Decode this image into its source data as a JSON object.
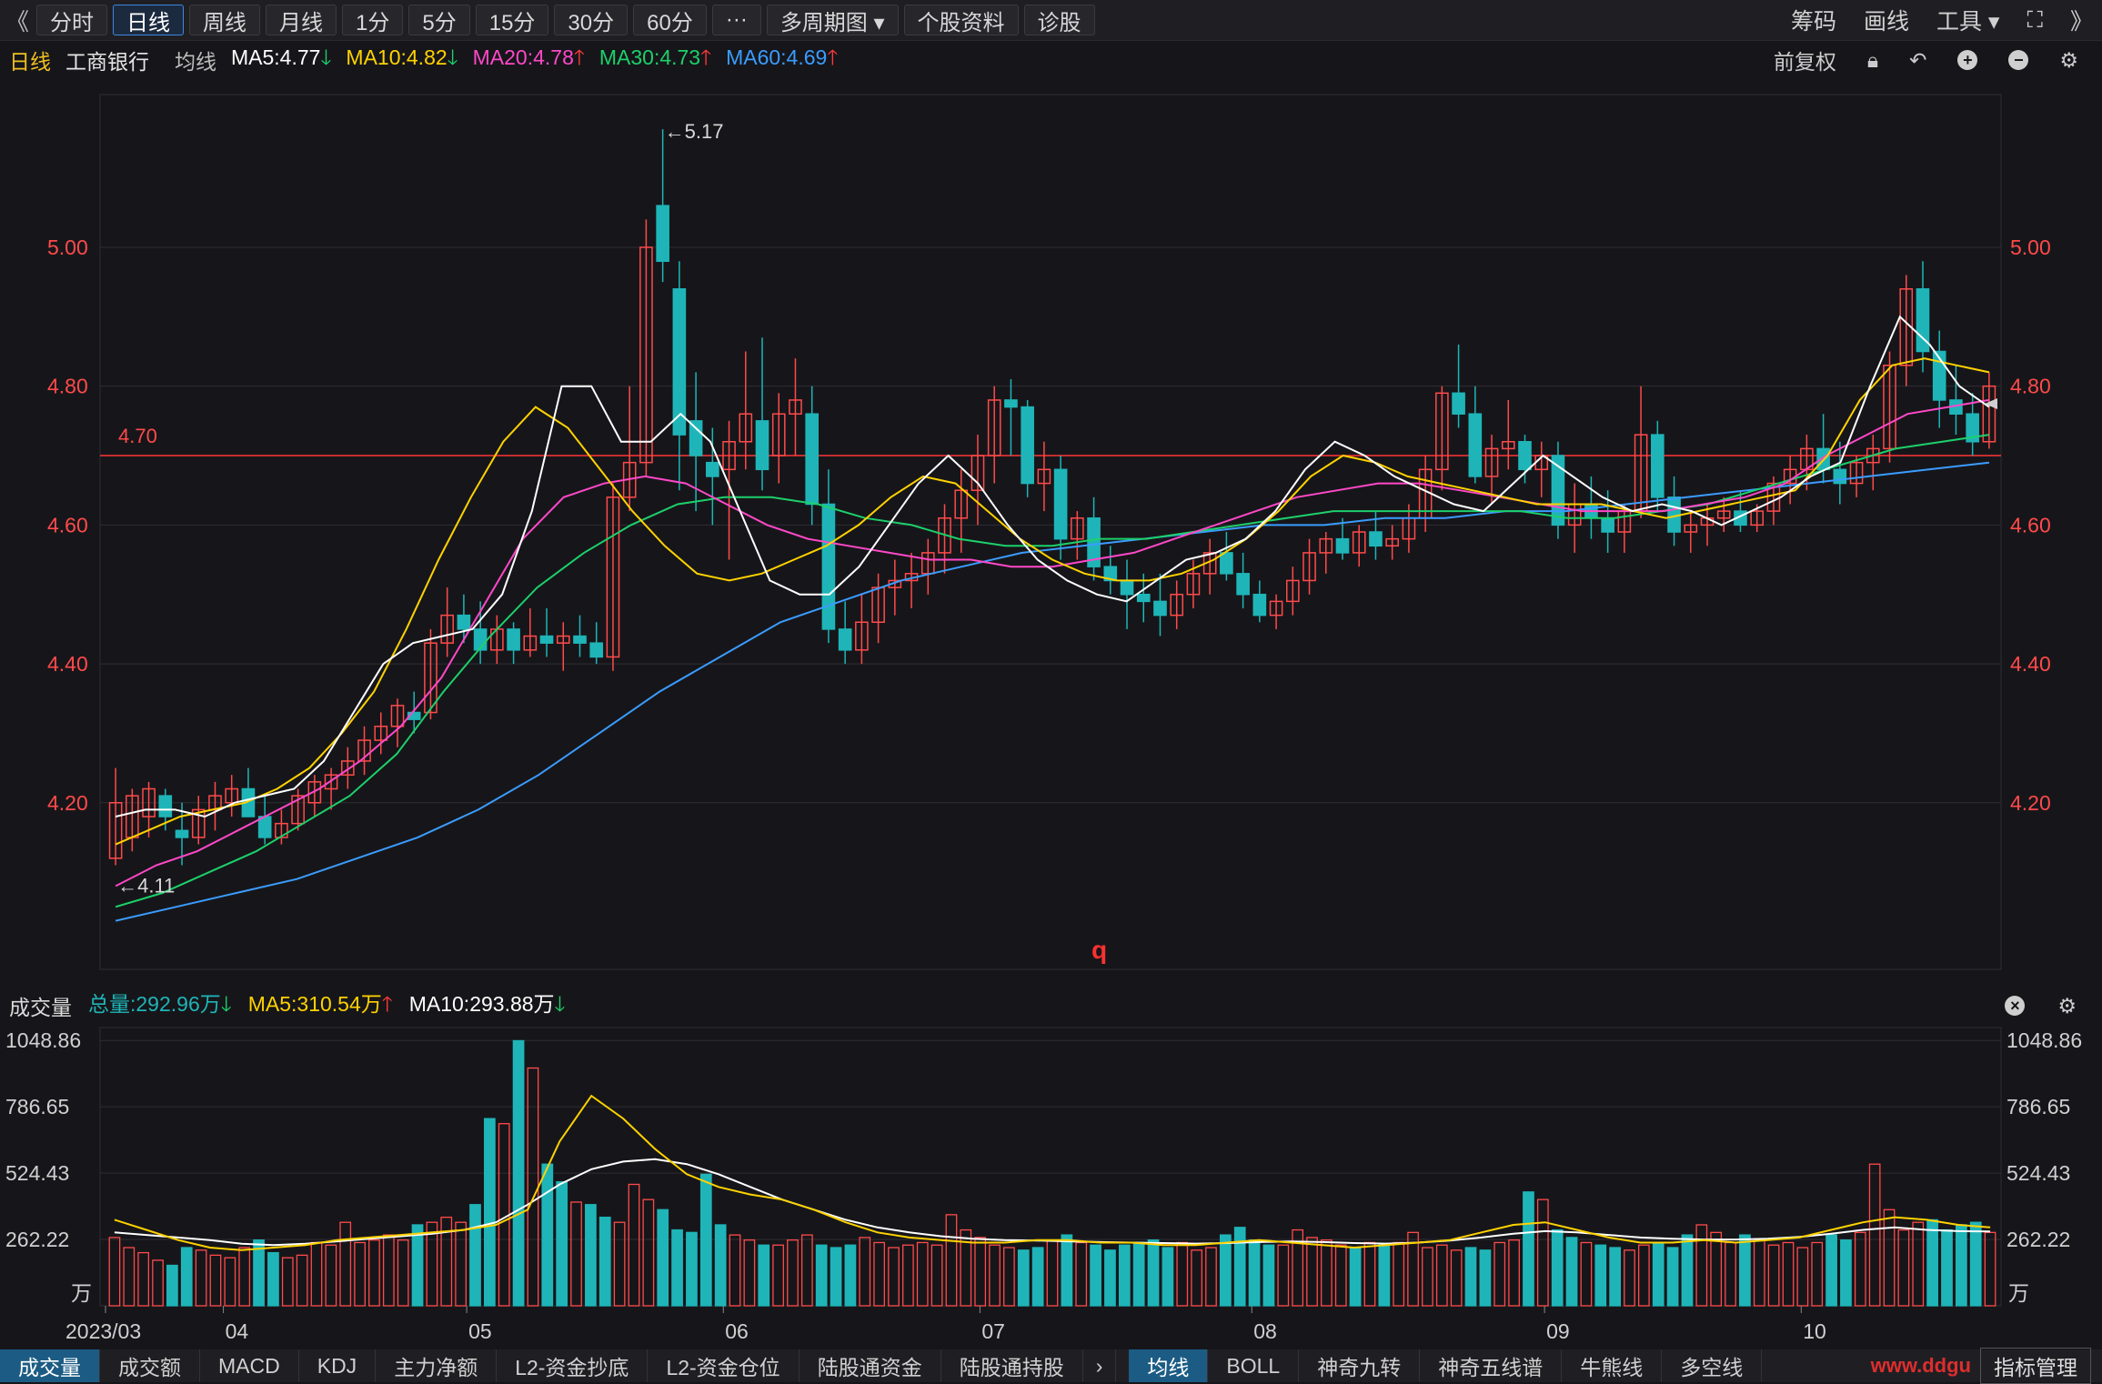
{
  "toolbar": {
    "back": "《",
    "periods": [
      "分时",
      "日线",
      "周线",
      "月线",
      "1分",
      "5分",
      "15分",
      "30分",
      "60分",
      "···",
      "多周期图 ▾",
      "个股资料",
      "诊股"
    ],
    "active_index": 1,
    "right": [
      "筹码",
      "画线",
      "工具 ▾"
    ],
    "expand": "⛶",
    "forward": "》"
  },
  "legend": {
    "period": "日线",
    "stock": "工商银行",
    "ma_label": "均线",
    "ma5": "MA5:4.77",
    "ma10": "MA10:4.82",
    "ma20": "MA20:4.78",
    "ma30": "MA30:4.73",
    "ma60": "MA60:4.69",
    "adjust": "前复权"
  },
  "colors": {
    "up": "#ff4a4a",
    "down": "#1fb5b8",
    "ma5": "#ffffff",
    "ma10": "#ffd200",
    "ma20": "#ff48c8",
    "ma30": "#1dd06a",
    "ma60": "#3b9cff"
  },
  "volume_legend": {
    "title": "成交量",
    "total": "总量:292.96万",
    "ma5": "MA5:310.54万",
    "ma10": "MA10:293.88万"
  },
  "chart_data": {
    "type": "candlestick",
    "price_axis": {
      "ticks": [
        "5.00",
        "4.80",
        "4.60",
        "4.40",
        "4.20"
      ]
    },
    "reference_line": {
      "value": 4.7,
      "label": "4.70"
    },
    "annotations": {
      "high": "←5.17",
      "low": "←4.11",
      "cursor_label": "q"
    },
    "x_labels": [
      "2023/03",
      "04",
      "05",
      "06",
      "07",
      "08",
      "09",
      "10"
    ],
    "candles_ohlc": [
      [
        4.12,
        4.25,
        4.11,
        4.2
      ],
      [
        4.15,
        4.22,
        4.13,
        4.21
      ],
      [
        4.18,
        4.23,
        4.15,
        4.22
      ],
      [
        4.21,
        4.22,
        4.16,
        4.18
      ],
      [
        4.16,
        4.2,
        4.11,
        4.15
      ],
      [
        4.15,
        4.21,
        4.14,
        4.19
      ],
      [
        4.19,
        4.23,
        4.16,
        4.21
      ],
      [
        4.2,
        4.24,
        4.18,
        4.22
      ],
      [
        4.22,
        4.25,
        4.18,
        4.18
      ],
      [
        4.18,
        4.21,
        4.14,
        4.15
      ],
      [
        4.15,
        4.19,
        4.14,
        4.17
      ],
      [
        4.17,
        4.22,
        4.16,
        4.21
      ],
      [
        4.2,
        4.24,
        4.18,
        4.23
      ],
      [
        4.22,
        4.25,
        4.19,
        4.24
      ],
      [
        4.24,
        4.28,
        4.22,
        4.26
      ],
      [
        4.26,
        4.31,
        4.24,
        4.29
      ],
      [
        4.29,
        4.33,
        4.27,
        4.31
      ],
      [
        4.31,
        4.35,
        4.28,
        4.34
      ],
      [
        4.33,
        4.36,
        4.3,
        4.32
      ],
      [
        4.33,
        4.45,
        4.32,
        4.43
      ],
      [
        4.43,
        4.51,
        4.41,
        4.47
      ],
      [
        4.47,
        4.5,
        4.43,
        4.45
      ],
      [
        4.45,
        4.49,
        4.4,
        4.42
      ],
      [
        4.42,
        4.47,
        4.4,
        4.45
      ],
      [
        4.45,
        4.46,
        4.4,
        4.42
      ],
      [
        4.42,
        4.48,
        4.41,
        4.44
      ],
      [
        4.44,
        4.48,
        4.41,
        4.43
      ],
      [
        4.43,
        4.46,
        4.39,
        4.44
      ],
      [
        4.44,
        4.47,
        4.41,
        4.43
      ],
      [
        4.43,
        4.46,
        4.4,
        4.41
      ],
      [
        4.41,
        4.66,
        4.39,
        4.64
      ],
      [
        4.64,
        4.8,
        4.62,
        4.69
      ],
      [
        4.69,
        5.04,
        4.67,
        5.0
      ],
      [
        5.06,
        5.17,
        4.95,
        4.98
      ],
      [
        4.94,
        4.98,
        4.65,
        4.73
      ],
      [
        4.75,
        4.82,
        4.62,
        4.7
      ],
      [
        4.69,
        4.74,
        4.6,
        4.67
      ],
      [
        4.68,
        4.75,
        4.55,
        4.72
      ],
      [
        4.72,
        4.85,
        4.68,
        4.76
      ],
      [
        4.75,
        4.87,
        4.65,
        4.68
      ],
      [
        4.7,
        4.79,
        4.66,
        4.76
      ],
      [
        4.76,
        4.84,
        4.7,
        4.78
      ],
      [
        4.76,
        4.8,
        4.6,
        4.63
      ],
      [
        4.63,
        4.68,
        4.43,
        4.45
      ],
      [
        4.45,
        4.49,
        4.4,
        4.42
      ],
      [
        4.42,
        4.5,
        4.4,
        4.46
      ],
      [
        4.46,
        4.53,
        4.43,
        4.51
      ],
      [
        4.51,
        4.55,
        4.47,
        4.52
      ],
      [
        4.52,
        4.56,
        4.48,
        4.53
      ],
      [
        4.53,
        4.58,
        4.5,
        4.56
      ],
      [
        4.56,
        4.63,
        4.53,
        4.61
      ],
      [
        4.61,
        4.68,
        4.56,
        4.65
      ],
      [
        4.65,
        4.73,
        4.6,
        4.7
      ],
      [
        4.7,
        4.8,
        4.66,
        4.78
      ],
      [
        4.78,
        4.81,
        4.7,
        4.77
      ],
      [
        4.77,
        4.78,
        4.64,
        4.66
      ],
      [
        4.66,
        4.72,
        4.62,
        4.68
      ],
      [
        4.68,
        4.7,
        4.55,
        4.58
      ],
      [
        4.58,
        4.62,
        4.55,
        4.61
      ],
      [
        4.61,
        4.64,
        4.52,
        4.54
      ],
      [
        4.54,
        4.57,
        4.5,
        4.52
      ],
      [
        4.52,
        4.55,
        4.45,
        4.5
      ],
      [
        4.5,
        4.53,
        4.46,
        4.49
      ],
      [
        4.49,
        4.53,
        4.44,
        4.47
      ],
      [
        4.47,
        4.52,
        4.45,
        4.5
      ],
      [
        4.5,
        4.55,
        4.48,
        4.53
      ],
      [
        4.53,
        4.58,
        4.5,
        4.56
      ],
      [
        4.56,
        4.59,
        4.52,
        4.53
      ],
      [
        4.53,
        4.56,
        4.48,
        4.5
      ],
      [
        4.5,
        4.52,
        4.46,
        4.47
      ],
      [
        4.47,
        4.5,
        4.45,
        4.49
      ],
      [
        4.49,
        4.54,
        4.47,
        4.52
      ],
      [
        4.52,
        4.58,
        4.5,
        4.56
      ],
      [
        4.56,
        4.59,
        4.53,
        4.58
      ],
      [
        4.58,
        4.61,
        4.55,
        4.56
      ],
      [
        4.56,
        4.6,
        4.54,
        4.59
      ],
      [
        4.59,
        4.62,
        4.55,
        4.57
      ],
      [
        4.57,
        4.6,
        4.55,
        4.58
      ],
      [
        4.58,
        4.63,
        4.56,
        4.61
      ],
      [
        4.61,
        4.7,
        4.59,
        4.68
      ],
      [
        4.68,
        4.8,
        4.65,
        4.79
      ],
      [
        4.79,
        4.86,
        4.74,
        4.76
      ],
      [
        4.76,
        4.8,
        4.66,
        4.67
      ],
      [
        4.67,
        4.73,
        4.63,
        4.71
      ],
      [
        4.71,
        4.78,
        4.68,
        4.72
      ],
      [
        4.72,
        4.73,
        4.66,
        4.68
      ],
      [
        4.68,
        4.72,
        4.64,
        4.7
      ],
      [
        4.7,
        4.72,
        4.58,
        4.6
      ],
      [
        4.6,
        4.66,
        4.56,
        4.63
      ],
      [
        4.63,
        4.67,
        4.58,
        4.61
      ],
      [
        4.61,
        4.65,
        4.56,
        4.59
      ],
      [
        4.59,
        4.63,
        4.56,
        4.62
      ],
      [
        4.62,
        4.8,
        4.61,
        4.73
      ],
      [
        4.73,
        4.75,
        4.62,
        4.64
      ],
      [
        4.64,
        4.67,
        4.57,
        4.59
      ],
      [
        4.59,
        4.62,
        4.56,
        4.6
      ],
      [
        4.6,
        4.63,
        4.57,
        4.61
      ],
      [
        4.61,
        4.64,
        4.59,
        4.62
      ],
      [
        4.62,
        4.65,
        4.59,
        4.6
      ],
      [
        4.6,
        4.63,
        4.59,
        4.62
      ],
      [
        4.62,
        4.67,
        4.6,
        4.66
      ],
      [
        4.66,
        4.7,
        4.63,
        4.68
      ],
      [
        4.68,
        4.73,
        4.65,
        4.71
      ],
      [
        4.71,
        4.76,
        4.66,
        4.68
      ],
      [
        4.68,
        4.72,
        4.63,
        4.66
      ],
      [
        4.66,
        4.7,
        4.64,
        4.69
      ],
      [
        4.69,
        4.73,
        4.65,
        4.71
      ],
      [
        4.71,
        4.85,
        4.69,
        4.83
      ],
      [
        4.83,
        4.96,
        4.8,
        4.94
      ],
      [
        4.94,
        4.98,
        4.82,
        4.85
      ],
      [
        4.85,
        4.88,
        4.74,
        4.78
      ],
      [
        4.78,
        4.83,
        4.73,
        4.76
      ],
      [
        4.76,
        4.79,
        4.7,
        4.72
      ],
      [
        4.72,
        4.82,
        4.71,
        4.8
      ]
    ],
    "ma5": [
      4.18,
      4.19,
      4.19,
      4.18,
      4.2,
      4.21,
      4.22,
      4.26,
      4.33,
      4.4,
      4.43,
      4.44,
      4.45,
      4.5,
      4.62,
      4.8,
      4.8,
      4.72,
      4.72,
      4.76,
      4.72,
      4.62,
      4.52,
      4.5,
      4.5,
      4.54,
      4.6,
      4.66,
      4.7,
      4.66,
      4.6,
      4.55,
      4.52,
      4.5,
      4.49,
      4.52,
      4.55,
      4.56,
      4.58,
      4.62,
      4.68,
      4.72,
      4.7,
      4.67,
      4.65,
      4.63,
      4.62,
      4.66,
      4.7,
      4.67,
      4.64,
      4.62,
      4.63,
      4.62,
      4.6,
      4.62,
      4.64,
      4.67,
      4.69,
      4.8,
      4.9,
      4.86,
      4.8,
      4.77
    ],
    "ma10": [
      4.14,
      4.16,
      4.18,
      4.19,
      4.2,
      4.22,
      4.25,
      4.3,
      4.36,
      4.45,
      4.55,
      4.64,
      4.72,
      4.77,
      4.74,
      4.68,
      4.62,
      4.57,
      4.53,
      4.52,
      4.53,
      4.55,
      4.57,
      4.6,
      4.64,
      4.67,
      4.66,
      4.62,
      4.58,
      4.55,
      4.53,
      4.52,
      4.52,
      4.53,
      4.55,
      4.58,
      4.62,
      4.67,
      4.7,
      4.69,
      4.67,
      4.66,
      4.65,
      4.64,
      4.63,
      4.63,
      4.63,
      4.62,
      4.61,
      4.62,
      4.63,
      4.64,
      4.65,
      4.7,
      4.78,
      4.83,
      4.84,
      4.83,
      4.82
    ],
    "ma20": [
      4.08,
      4.11,
      4.13,
      4.16,
      4.19,
      4.22,
      4.26,
      4.31,
      4.38,
      4.48,
      4.58,
      4.64,
      4.66,
      4.67,
      4.66,
      4.63,
      4.6,
      4.58,
      4.57,
      4.56,
      4.55,
      4.55,
      4.54,
      4.54,
      4.55,
      4.56,
      4.58,
      4.6,
      4.62,
      4.64,
      4.65,
      4.66,
      4.66,
      4.65,
      4.64,
      4.63,
      4.62,
      4.62,
      4.62,
      4.63,
      4.64,
      4.66,
      4.7,
      4.73,
      4.76,
      4.77,
      4.78
    ],
    "ma30": [
      4.05,
      4.07,
      4.1,
      4.13,
      4.17,
      4.21,
      4.27,
      4.36,
      4.44,
      4.51,
      4.56,
      4.6,
      4.63,
      4.64,
      4.64,
      4.63,
      4.61,
      4.6,
      4.58,
      4.57,
      4.57,
      4.58,
      4.58,
      4.59,
      4.6,
      4.61,
      4.62,
      4.62,
      4.62,
      4.62,
      4.62,
      4.61,
      4.61,
      4.62,
      4.63,
      4.65,
      4.67,
      4.69,
      4.71,
      4.72,
      4.73
    ],
    "ma60": [
      4.03,
      4.05,
      4.07,
      4.09,
      4.12,
      4.15,
      4.19,
      4.24,
      4.3,
      4.36,
      4.41,
      4.46,
      4.49,
      4.52,
      4.54,
      4.56,
      4.57,
      4.58,
      4.59,
      4.6,
      4.6,
      4.61,
      4.61,
      4.62,
      4.62,
      4.63,
      4.64,
      4.65,
      4.66,
      4.67,
      4.68,
      4.69
    ],
    "volume_axis": {
      "ticks": [
        "1048.86",
        "786.65",
        "524.43",
        "262.22"
      ],
      "unit": "万"
    },
    "volume_values": [
      270,
      230,
      210,
      180,
      160,
      230,
      220,
      200,
      190,
      230,
      260,
      210,
      190,
      200,
      250,
      240,
      330,
      250,
      260,
      280,
      260,
      320,
      330,
      350,
      330,
      400,
      740,
      720,
      1048,
      940,
      560,
      490,
      410,
      400,
      350,
      330,
      480,
      420,
      380,
      300,
      290,
      520,
      320,
      280,
      260,
      240,
      240,
      260,
      280,
      240,
      230,
      240,
      270,
      250,
      230,
      240,
      250,
      240,
      360,
      300,
      270,
      240,
      230,
      220,
      230,
      260,
      280,
      250,
      240,
      220,
      240,
      250,
      260,
      230,
      250,
      220,
      230,
      280,
      310,
      260,
      240,
      240,
      300,
      270,
      260,
      240,
      230,
      250,
      240,
      250,
      290,
      230,
      240,
      220,
      230,
      220,
      250,
      260,
      450,
      420,
      300,
      270,
      250,
      240,
      230,
      220,
      240,
      250,
      230,
      280,
      320,
      290,
      250,
      280,
      260,
      240,
      250,
      230,
      250,
      280,
      260,
      290,
      560,
      380,
      300,
      330,
      340,
      300,
      320,
      330,
      290
    ],
    "vol_ma5": [
      340,
      300,
      260,
      230,
      220,
      230,
      240,
      260,
      270,
      280,
      290,
      300,
      320,
      380,
      650,
      830,
      740,
      620,
      520,
      470,
      440,
      420,
      380,
      330,
      290,
      270,
      260,
      250,
      250,
      260,
      260,
      250,
      250,
      240,
      240,
      250,
      260,
      250,
      240,
      230,
      240,
      250,
      260,
      290,
      320,
      330,
      300,
      270,
      250,
      250,
      260,
      250,
      260,
      270,
      300,
      330,
      350,
      340,
      320,
      310
    ],
    "vol_ma10": [
      290,
      280,
      270,
      260,
      245,
      240,
      245,
      255,
      265,
      275,
      285,
      300,
      330,
      400,
      480,
      540,
      570,
      580,
      560,
      520,
      470,
      420,
      380,
      340,
      310,
      290,
      275,
      265,
      260,
      258,
      255,
      252,
      250,
      248,
      246,
      248,
      252,
      254,
      252,
      248,
      246,
      250,
      258,
      270,
      285,
      295,
      290,
      280,
      270,
      265,
      262,
      262,
      265,
      272,
      285,
      300,
      310,
      300,
      295,
      294
    ],
    "volume_x_labels": [
      "2023/03",
      "04",
      "05",
      "06",
      "07",
      "08",
      "09",
      "10"
    ]
  },
  "bottom_tabs": [
    "成交量",
    "成交额",
    "MACD",
    "KDJ",
    "主力净额",
    "L2-资金抄底",
    "L2-资金仓位",
    "陆股通资金",
    "陆股通持股"
  ],
  "bottom_tabs_right": [
    "均线",
    "BOLL",
    "神奇九转",
    "神奇五线谱",
    "牛熊线",
    "多空线"
  ],
  "bottom_right_btn": "指标管理",
  "watermark": "www.ddgu"
}
